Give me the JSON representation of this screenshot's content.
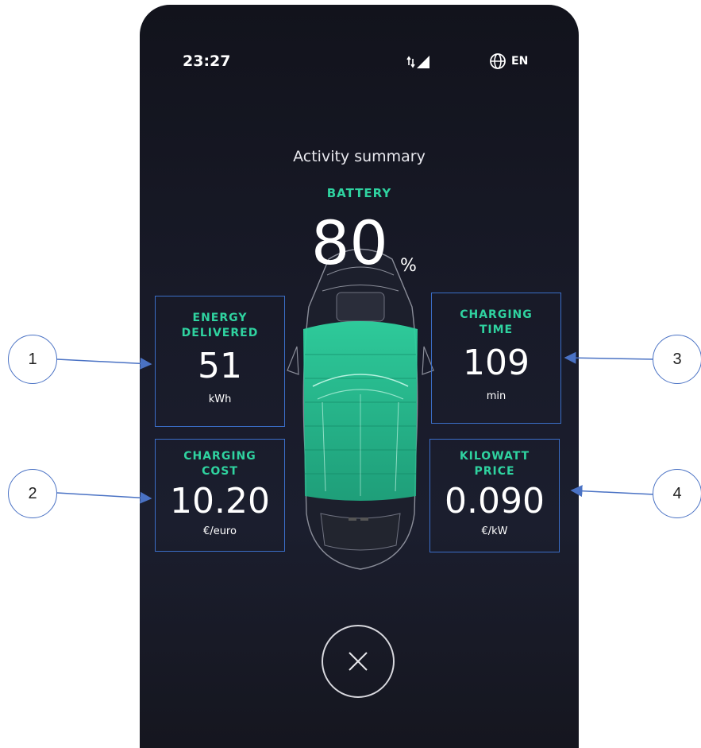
{
  "status_bar": {
    "time": "23:27",
    "language": "EN"
  },
  "screen": {
    "title": "Activity summary",
    "battery_label": "BATTERY",
    "battery_value": "80",
    "battery_unit": "%"
  },
  "stats": [
    {
      "label": "ENERGY\nDELIVERED",
      "value": "51",
      "unit": "kWh"
    },
    {
      "label": "CHARGING\nCOST",
      "value": "10.20",
      "unit": "€/euro"
    },
    {
      "label": "CHARGING\nTIME",
      "value": "109",
      "unit": "min"
    },
    {
      "label": "KILOWATT\nPRICE",
      "value": "0.090",
      "unit": "€/kW"
    }
  ],
  "callouts": [
    "1",
    "2",
    "3",
    "4"
  ],
  "colors": {
    "accent": "#2fd3a0",
    "box_border": "#3b6ec8",
    "background": "#181a28"
  },
  "icons": {
    "signal": "signal-icon",
    "globe": "globe-icon",
    "close": "close-icon",
    "car": "car-icon"
  }
}
